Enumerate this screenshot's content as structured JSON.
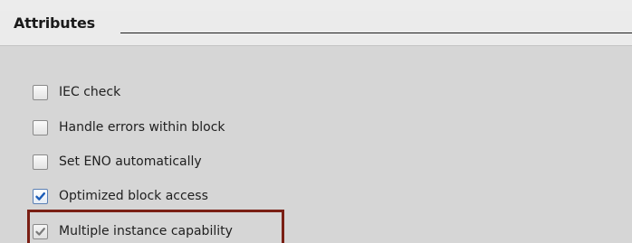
{
  "section": {
    "title": "Attributes"
  },
  "attributes": [
    {
      "label": "IEC check",
      "checked": false,
      "enabled": true
    },
    {
      "label": "Handle errors within block",
      "checked": false,
      "enabled": true
    },
    {
      "label": "Set ENO automatically",
      "checked": false,
      "enabled": true
    },
    {
      "label": "Optimized block access",
      "checked": true,
      "enabled": true
    },
    {
      "label": "Multiple instance capability",
      "checked": true,
      "enabled": false
    }
  ],
  "colors": {
    "highlight_border": "#7a1f14",
    "check_active": "#1b5cb8",
    "check_disabled": "#7a7a7a"
  }
}
